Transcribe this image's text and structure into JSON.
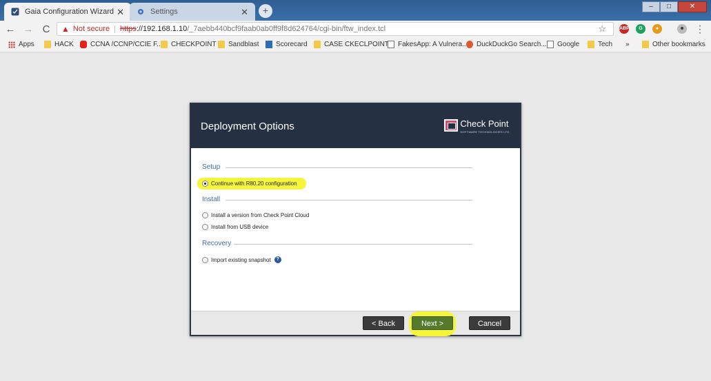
{
  "browser": {
    "tabs": [
      {
        "label": "Gaia Configuration Wizard",
        "active": true
      },
      {
        "label": "Settings",
        "active": false
      }
    ],
    "address": {
      "not_secure": "Not secure",
      "scheme": "https",
      "host": "://192.168.1.10",
      "path": "/_7aebb440bcf9faab0ab0ff9f8d624764/cgi-bin/ftw_index.tcl"
    },
    "window_controls": {
      "minimize": "–",
      "maximize": "□",
      "close": "✕"
    },
    "bookmarks": [
      {
        "label": "Apps",
        "icon": "apps-grid-icon"
      },
      {
        "label": "HACK",
        "icon": "folder-icon"
      },
      {
        "label": "CCNA /CCNP/CCIE F...",
        "icon": "youtube-icon"
      },
      {
        "label": "CHECKPOINT",
        "icon": "folder-icon"
      },
      {
        "label": "Sandblast",
        "icon": "folder-icon"
      },
      {
        "label": "Scorecard",
        "icon": "scorecard-icon"
      },
      {
        "label": "CASE CKECLPOINT",
        "icon": "folder-icon"
      },
      {
        "label": "FakesApp: A Vulnera...",
        "icon": "page-icon"
      },
      {
        "label": "DuckDuckGo Search...",
        "icon": "duckduckgo-icon"
      },
      {
        "label": "Google",
        "icon": "page-icon"
      },
      {
        "label": "Tech",
        "icon": "folder-icon"
      },
      {
        "label": "»",
        "icon": ""
      },
      {
        "label": "Other bookmarks",
        "icon": "folder-icon"
      }
    ],
    "extensions": [
      "ABP",
      "G",
      "☻"
    ]
  },
  "dialog": {
    "title": "Deployment Options",
    "logo_text": "Check Point",
    "logo_sub": "SOFTWARE TECHNOLOGIES LTD.",
    "sections": {
      "setup": {
        "title": "Setup",
        "options": [
          {
            "label": "Continue with R80.20 configuration",
            "checked": true
          }
        ]
      },
      "install": {
        "title": "Install",
        "options": [
          {
            "label": "Install a version from Check Point Cloud",
            "checked": false
          },
          {
            "label": "Install from USB device",
            "checked": false
          }
        ]
      },
      "recovery": {
        "title": "Recovery",
        "options": [
          {
            "label": "Import existing snapshot",
            "checked": false
          }
        ]
      }
    },
    "buttons": {
      "back": "< Back",
      "next": "Next >",
      "cancel": "Cancel"
    },
    "highlight_color": "#f5f53a",
    "accent_color": "#3c6ea6",
    "header_color": "#253042"
  }
}
